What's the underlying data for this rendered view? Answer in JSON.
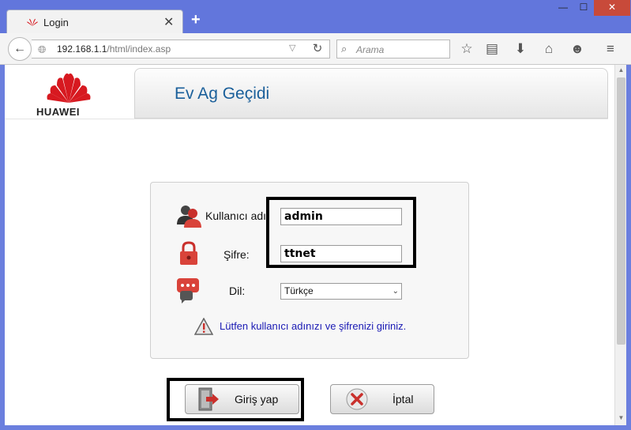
{
  "browser": {
    "tab_title": "Login",
    "tab_close": "✕",
    "new_tab": "+",
    "window_controls": {
      "minimize": "—",
      "maximize": "☐",
      "close": "✕"
    },
    "url_host": "192.168.1.1",
    "url_path": "/html/index.asp",
    "search_placeholder": "Arama",
    "icons": [
      "back-icon",
      "globe-icon",
      "reload-icon",
      "search-icon",
      "bookmark-star-icon",
      "reading-list-icon",
      "download-icon",
      "home-icon",
      "emoji-icon",
      "menu-icon"
    ]
  },
  "header": {
    "brand": "HUAWEI",
    "title": "Ev Ag Geçidi"
  },
  "login": {
    "username_label": "Kullanıcı adı:",
    "username_value": "admin",
    "password_label": "Şifre:",
    "password_value": "ttnet",
    "language_label": "Dil:",
    "language_selected": "Türkçe",
    "message": "Lütfen kullanıcı adınızı ve şifrenizi giriniz."
  },
  "buttons": {
    "login": "Giriş yap",
    "cancel": "İptal"
  },
  "colors": {
    "titlebar": "#6276dc",
    "header_title": "#1a5f9a",
    "message": "#1a1ab4",
    "huawei_red": "#d71920"
  }
}
